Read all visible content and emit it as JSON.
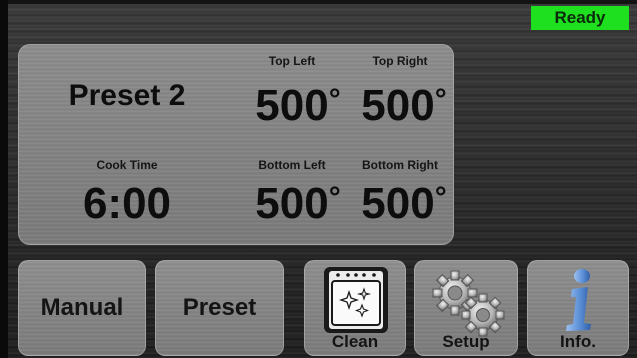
{
  "status": {
    "label": "Ready",
    "color": "#1fe01f"
  },
  "preset": {
    "name": "Preset 2"
  },
  "cook_time": {
    "label": "Cook Time",
    "value": "6:00"
  },
  "zones": [
    {
      "label": "Top Left",
      "value": "500",
      "unit": "°"
    },
    {
      "label": "Top Right",
      "value": "500",
      "unit": "°"
    },
    {
      "label": "Bottom Left",
      "value": "500",
      "unit": "°"
    },
    {
      "label": "Bottom Right",
      "value": "500",
      "unit": "°"
    }
  ],
  "buttons": {
    "manual": {
      "label": "Manual"
    },
    "preset": {
      "label": "Preset"
    },
    "clean": {
      "label": "Clean",
      "icon": "oven-clean-icon"
    },
    "setup": {
      "label": "Setup",
      "icon": "gears-icon"
    },
    "info": {
      "label": "Info.",
      "icon": "info-icon",
      "color": "#5b8fd6"
    }
  }
}
